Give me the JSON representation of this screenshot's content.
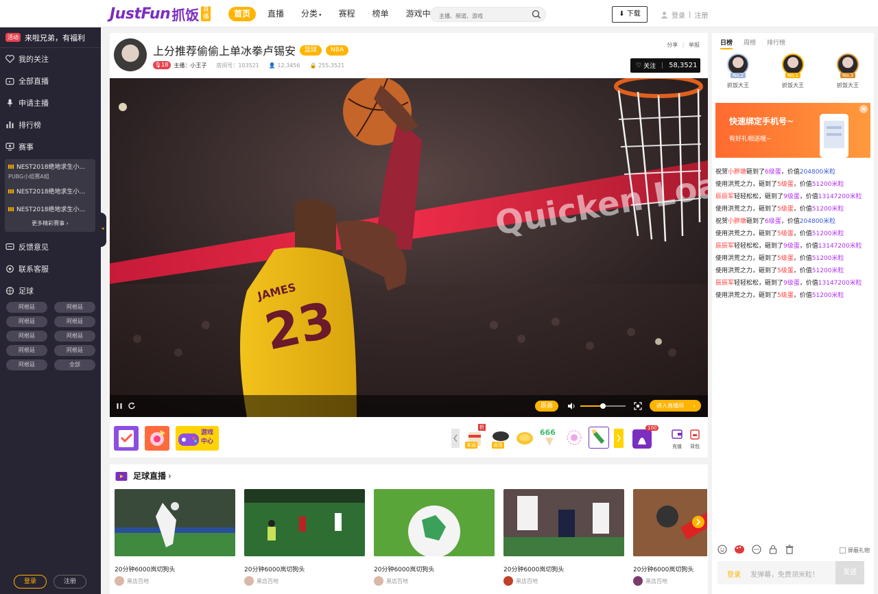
{
  "brand": {
    "logo_word": "JustFun",
    "logo_cn": "抓饭",
    "logo_tag": "直播"
  },
  "nav": {
    "items": [
      "首页",
      "直播",
      "分类",
      "赛程",
      "榜单",
      "游戏中心"
    ],
    "active": "首页",
    "search_placeholder": "主播、频道、游戏",
    "download": "下载",
    "login": "登录",
    "register": "注册"
  },
  "sidebar": {
    "promo_badge": "活动",
    "promo_text": "来啦兄弟，有福利",
    "items": [
      "我的关注",
      "全部直播",
      "申请主播",
      "排行榜",
      "赛事"
    ],
    "matches": [
      {
        "title": "NEST2018绝地求生小...",
        "sub": "PUBG小组赛A组"
      },
      {
        "title": "NEST2018绝地求生小...",
        "sub": ""
      },
      {
        "title": "NEST2018绝地求生小...",
        "sub": ""
      }
    ],
    "more_matches": "更多精彩赛事",
    "items2": [
      "反馈意见",
      "联系客服",
      "足球"
    ],
    "tags": [
      "阿根廷",
      "阿根廷",
      "阿根廷",
      "阿根廷",
      "阿根廷",
      "阿根廷",
      "阿根廷",
      "阿根廷",
      "阿根廷",
      "全部"
    ],
    "login": "登录",
    "register": "注册"
  },
  "room": {
    "title": "上分推荐偷偷上单冰拳卢锡安",
    "tags": [
      "篮球",
      "NBA"
    ],
    "level": "18",
    "host_label": "主播：小王子",
    "room_id": "房间号：103521",
    "viewers": "12,3456",
    "followers": "255,3521",
    "share": "分享",
    "report": "举报",
    "follow_label": "关注",
    "follow_count": "58,3521",
    "jersey_name": "JAMES",
    "jersey_number": "23",
    "arena_text": "Quicken Loans",
    "quality": "原画",
    "volume": 0.5,
    "enter_room": "进入直播间",
    "gifts": [
      {
        "badge": "幸运",
        "corner": "折"
      },
      {
        "badge": "返现",
        "corner": ""
      },
      {
        "badge": "",
        "corner": ""
      },
      {
        "badge": "",
        "corner": "",
        "text": "666"
      },
      {
        "badge": "",
        "corner": ""
      },
      {
        "badge": "",
        "corner": ""
      }
    ],
    "bag_count": "100",
    "recharge": "充值",
    "backpack": "背包",
    "game_center": "游戏中心"
  },
  "feed": {
    "title": "足球直播",
    "cards": [
      {
        "title": "20分钟6000岚切狗头",
        "author": "黑店百地"
      },
      {
        "title": "20分钟6000岚切狗头",
        "author": "黑店百地"
      },
      {
        "title": "20分钟6000岚切狗头",
        "author": "黑店百地"
      },
      {
        "title": "20分钟6000岚切狗头",
        "author": "黑店百地"
      },
      {
        "title": "20分钟6000岚切狗头",
        "author": "黑店百地"
      }
    ]
  },
  "rank": {
    "tabs": [
      "日榜",
      "周榜",
      "排行榜"
    ],
    "active": "日榜",
    "podium": [
      {
        "rank": "No.2",
        "name": "抓饭大王"
      },
      {
        "rank": "No.1",
        "name": "抓饭大王"
      },
      {
        "rank": "No.3",
        "name": "抓饭大王"
      }
    ]
  },
  "banner": {
    "headline": "快速绑定手机号~",
    "sub": "有好礼相送哦~"
  },
  "chat": [
    {
      "a": "祝贺",
      "b": "小胖墩",
      "c": "砸到了",
      "d": "6级蛋",
      "e": "，价值",
      "f": "204800米粒",
      "colors": [
        "red",
        "pur",
        "blu"
      ]
    },
    {
      "a": "使用洪荒之力，砸到了",
      "b": "",
      "c": "",
      "d": "5级蛋",
      "e": "，价值",
      "f": "51200米粒",
      "colors": [
        "red",
        "red",
        "pur"
      ]
    },
    {
      "a": "",
      "b": "辰辰军",
      "c": "轻轻松松，砸到了",
      "d": "9级蛋",
      "e": "，价值",
      "f": "13147200米粒",
      "colors": [
        "red",
        "pur",
        "pur"
      ]
    },
    {
      "a": "使用洪荒之力，砸到了",
      "b": "",
      "c": "",
      "d": "5级蛋",
      "e": "，价值",
      "f": "51200米粒",
      "colors": [
        "red",
        "red",
        "pur"
      ]
    },
    {
      "a": "祝贺",
      "b": "小胖墩",
      "c": "砸到了",
      "d": "6级蛋",
      "e": "，价值",
      "f": "204800米粒",
      "colors": [
        "red",
        "pur",
        "blu"
      ]
    },
    {
      "a": "使用洪荒之力，砸到了",
      "b": "",
      "c": "",
      "d": "5级蛋",
      "e": "，价值",
      "f": "51200米粒",
      "colors": [
        "red",
        "red",
        "pur"
      ]
    },
    {
      "a": "",
      "b": "辰辰军",
      "c": "轻轻松松，砸到了",
      "d": "9级蛋",
      "e": "，价值",
      "f": "13147200米粒",
      "colors": [
        "red",
        "pur",
        "pur"
      ]
    },
    {
      "a": "使用洪荒之力，砸到了",
      "b": "",
      "c": "",
      "d": "5级蛋",
      "e": "，价值",
      "f": "51200米粒",
      "colors": [
        "red",
        "red",
        "pur"
      ]
    },
    {
      "a": "使用洪荒之力，砸到了",
      "b": "",
      "c": "",
      "d": "5级蛋",
      "e": "，价值",
      "f": "51200米粒",
      "colors": [
        "red",
        "red",
        "pur"
      ]
    },
    {
      "a": "",
      "b": "辰辰军",
      "c": "轻轻松松，砸到了",
      "d": "9级蛋",
      "e": "，价值",
      "f": "13147200米粒",
      "colors": [
        "red",
        "pur",
        "pur"
      ]
    },
    {
      "a": "使用洪荒之力，砸到了",
      "b": "",
      "c": "",
      "d": "5级蛋",
      "e": "，价值",
      "f": "51200米粒",
      "colors": [
        "red",
        "red",
        "pur"
      ]
    }
  ],
  "chat_box": {
    "block_gifts": "屏蔽礼物",
    "login": "登录",
    "placeholder": "发弹幕，免费领米粒！",
    "send": "发送"
  },
  "colors": {
    "accent": "#ffb400",
    "brand": "#7b2fbe",
    "sidebar": "#272433"
  }
}
